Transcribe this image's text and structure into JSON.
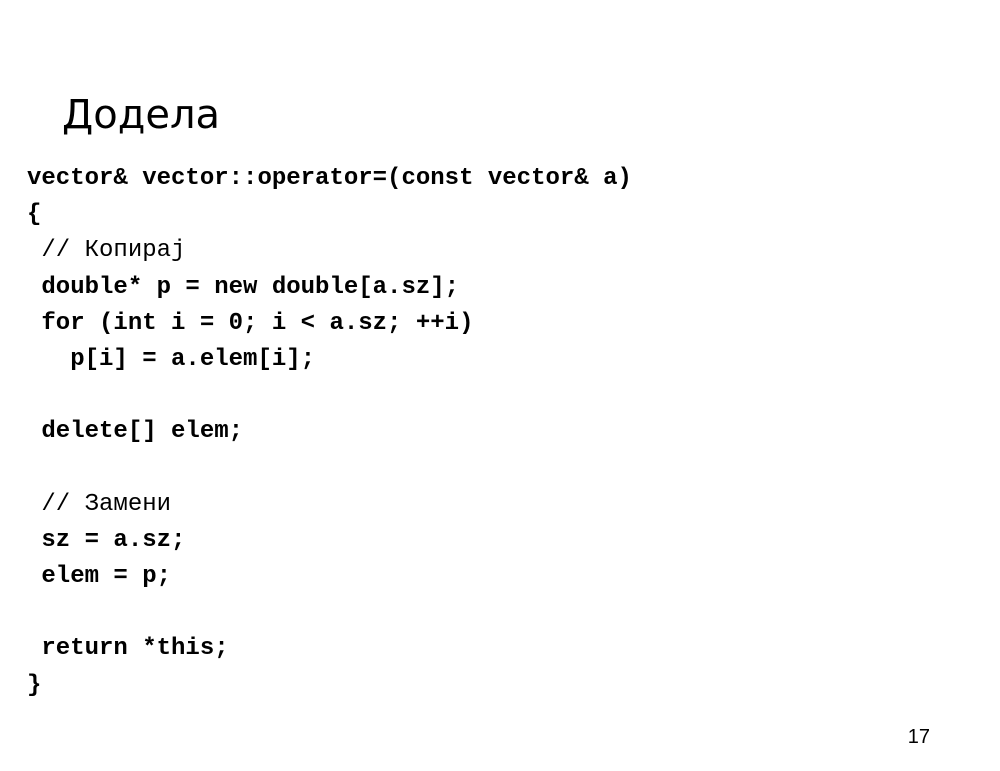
{
  "slide": {
    "title": "Додела",
    "page_number": "17"
  },
  "code": {
    "lines": [
      {
        "text": "vector& vector::operator=(const vector& a)",
        "style": "bold"
      },
      {
        "text": "{",
        "style": "bold"
      },
      {
        "text": " // Копирај",
        "style": "comment"
      },
      {
        "text": " double* p = new double[a.sz];",
        "style": "bold"
      },
      {
        "text": " for (int i = 0; i < a.sz; ++i)",
        "style": "bold"
      },
      {
        "text": "   p[i] = a.elem[i];",
        "style": "bold"
      },
      {
        "text": "",
        "style": "bold"
      },
      {
        "text": " delete[] elem;",
        "style": "bold"
      },
      {
        "text": "",
        "style": "bold"
      },
      {
        "text": " // Замени",
        "style": "comment"
      },
      {
        "text": " sz = a.sz;",
        "style": "bold"
      },
      {
        "text": " elem = p;",
        "style": "bold"
      },
      {
        "text": "",
        "style": "bold"
      },
      {
        "text": " return *this;",
        "style": "bold"
      },
      {
        "text": "}",
        "style": "bold"
      }
    ]
  }
}
